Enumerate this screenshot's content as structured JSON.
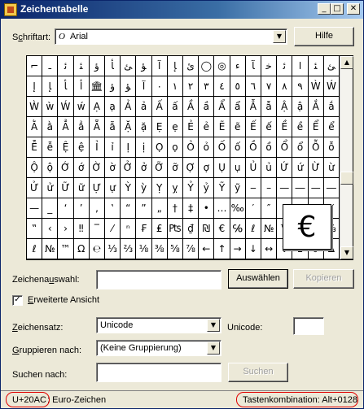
{
  "window": {
    "title": "Zeichentabelle",
    "controls": [
      "_",
      "□",
      "✕"
    ]
  },
  "font_row": {
    "label_prefix": "S",
    "label_u": "c",
    "label_suffix": "hriftart:",
    "font_icon": "O",
    "value": "Arial",
    "help_label": "Hilfe"
  },
  "grid": [
    [
      "⌐",
      "ـ",
      "ﺋ",
      "ﺌ",
      "ﺅ",
      "ﺄ",
      "ﺊ",
      "ﺆ",
      "ﺁ",
      "ﺈ",
      "ﺉ",
      "◯",
      "◎",
      "ﺀ",
      "ﺂ",
      "ﺧ",
      "ﺋ",
      "ﺍ",
      "ﺌ",
      "ﺊ"
    ],
    [
      "ﺇ",
      "ﺈ",
      "ﺄ",
      "ﺃ",
      "🏛",
      "ﺅ",
      "ﺆ",
      "ﺁ",
      "٠",
      "١",
      "٢",
      "٣",
      "٤",
      "٥",
      "٦",
      "٧",
      "٨",
      "٩",
      "Ẁ",
      "Ẃ"
    ],
    [
      "Ẁ",
      "ẁ",
      "Ẃ",
      "ẃ",
      "Ạ",
      "ạ",
      "Ả",
      "ả",
      "Ấ",
      "ấ",
      "Ầ",
      "ầ",
      "Ẩ",
      "ẩ",
      "Ẫ",
      "ẫ",
      "Ậ",
      "ậ",
      "Ắ",
      "ắ"
    ],
    [
      "Ằ",
      "ằ",
      "Ẳ",
      "ẳ",
      "Ẵ",
      "ẵ",
      "Ặ",
      "ặ",
      "Ẹ",
      "ẹ",
      "Ẻ",
      "ẻ",
      "Ẽ",
      "ẽ",
      "Ế",
      "ế",
      "Ề",
      "ề",
      "Ể",
      "ể"
    ],
    [
      "Ễ",
      "ễ",
      "Ệ",
      "ệ",
      "Ỉ",
      "ỉ",
      "Ị",
      "ị",
      "Ọ",
      "ọ",
      "Ỏ",
      "ỏ",
      "Ố",
      "ố",
      "Ồ",
      "ồ",
      "Ổ",
      "ổ",
      "Ỗ",
      "ỗ"
    ],
    [
      "Ộ",
      "ộ",
      "Ớ",
      "ớ",
      "Ờ",
      "ờ",
      "Ở",
      "ở",
      "Ỡ",
      "ỡ",
      "Ợ",
      "ợ",
      "Ụ",
      "ụ",
      "Ủ",
      "ủ",
      "Ứ",
      "ứ",
      "Ừ",
      "ừ"
    ],
    [
      "Ử",
      "ử",
      "Ữ",
      "ữ",
      "Ự",
      "ự",
      "Ỳ",
      "ỳ",
      "Ỵ",
      "ỵ",
      "Ỷ",
      "ỷ",
      "Ỹ",
      "ỹ",
      "‒",
      "–",
      "—",
      "―",
      "—",
      "―"
    ],
    [
      "—",
      "_",
      "‘",
      "’",
      "‚",
      "‛",
      "“",
      "”",
      "„",
      "†",
      "‡",
      "•",
      "…",
      "‰",
      "′",
      "″",
      "‹",
      "›",
      "‼",
      "⁄"
    ],
    [
      "‟",
      "‹",
      "›",
      "‼",
      "‾",
      "⁄",
      "ⁿ",
      "₣",
      "₤",
      "₧",
      "₫",
      "₪",
      "€",
      "℅",
      "ℓ",
      "№",
      "™",
      "Ω",
      "℮",
      "⅓"
    ],
    [
      "ℓ",
      "№",
      "™",
      "Ω",
      "℮",
      "⅓",
      "⅔",
      "⅛",
      "⅜",
      "⅝",
      "⅞",
      "←",
      "↑",
      "→",
      "↓",
      "↔",
      "↕",
      "↨",
      "∂",
      "∆"
    ]
  ],
  "magnified_char": "€",
  "selection": {
    "label_prefix": "Zeichena",
    "label_u": "u",
    "label_suffix": "swahl:",
    "value": "",
    "select_label": "Auswählen",
    "copy_label": "Kopieren"
  },
  "advanced": {
    "checked": true,
    "check_mark": "✓",
    "label_u": "E",
    "label_suffix": "rweiterte Ansicht"
  },
  "charset": {
    "label_u": "Z",
    "label_suffix": "eichensatz:",
    "value": "Unicode",
    "unicode_label": "Unicode:",
    "unicode_value": ""
  },
  "group": {
    "label_u": "G",
    "label_suffix": "ruppieren nach:",
    "value": "(Keine Gruppierung)"
  },
  "search": {
    "label_prefix": "Suchen nach:",
    "value": "",
    "button_label": "Suchen"
  },
  "status": {
    "code": "U+20AC",
    "name": ": Euro-Zeichen",
    "keystroke": "Tastenkombination: Alt+0128"
  },
  "colors": {
    "title_start": "#0a246a",
    "annotation_ring": "#e00000",
    "face": "#ece9d8"
  }
}
